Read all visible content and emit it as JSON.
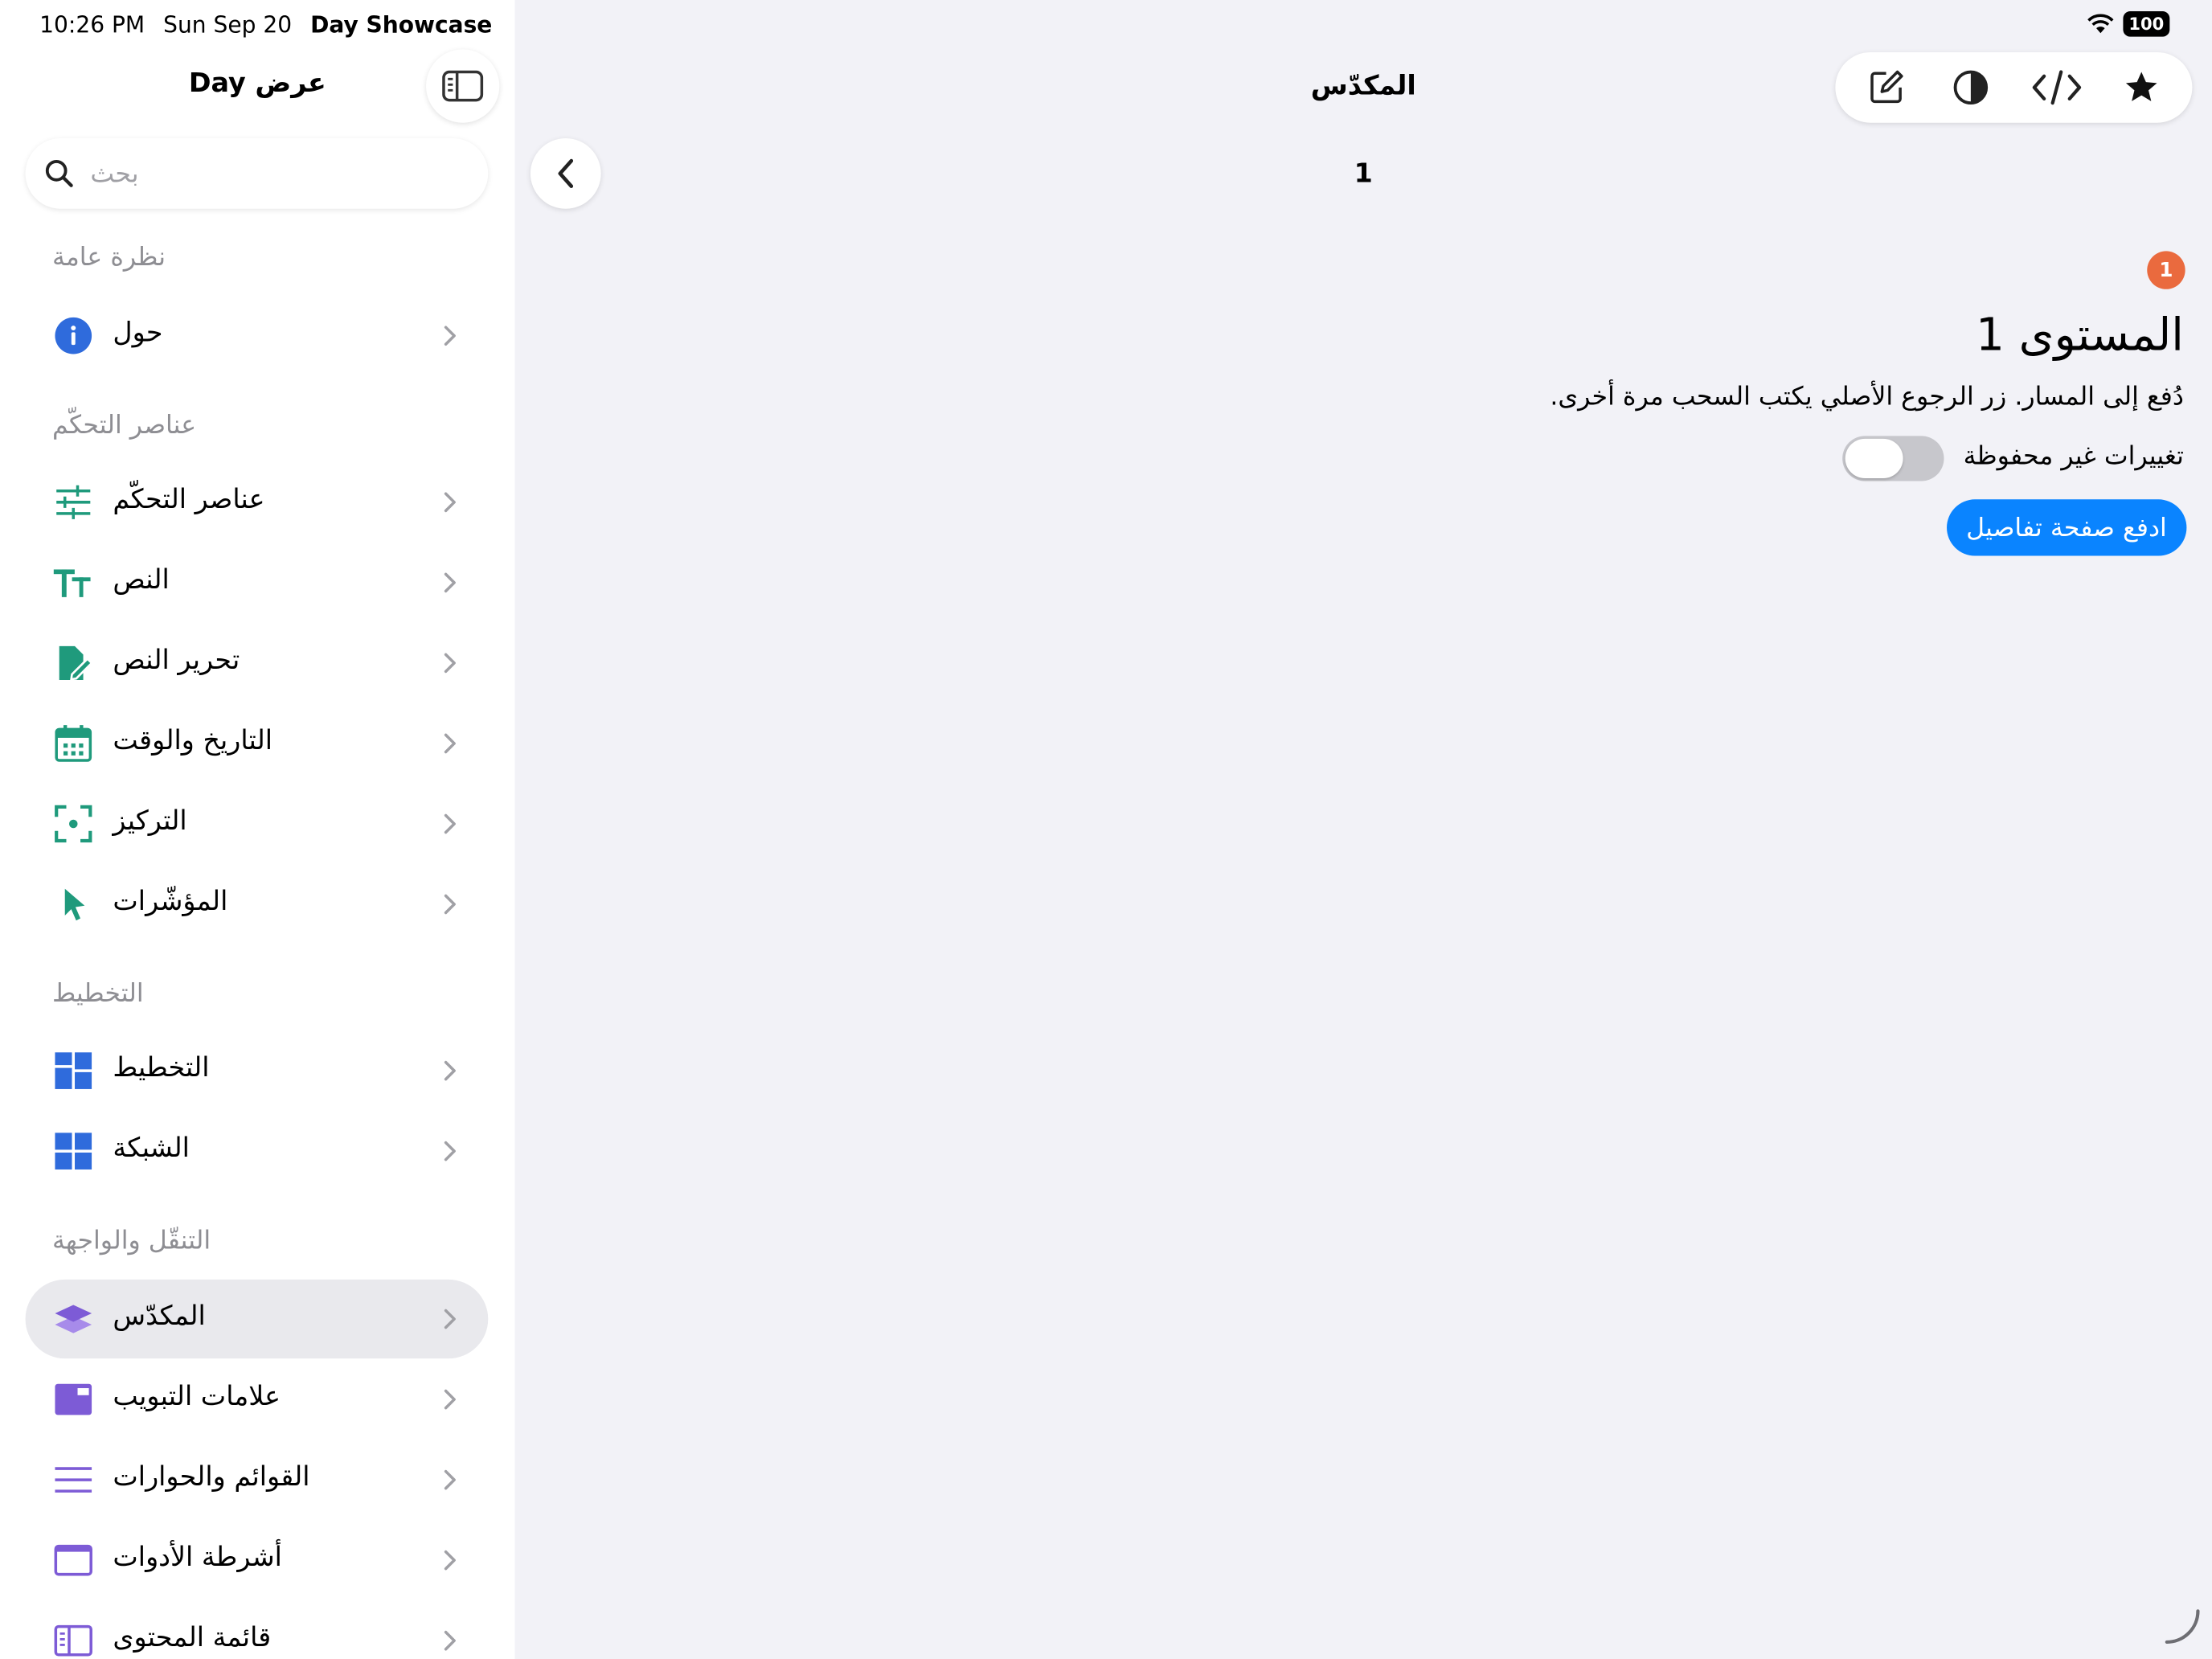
{
  "status_bar": {
    "time": "10:26 PM",
    "date": "Sun Sep 20",
    "app_name": "Day Showcase",
    "battery": "100"
  },
  "sidebar": {
    "title": "عرض Day",
    "search_placeholder": "بحث",
    "sections": [
      {
        "header": "نظرة عامة",
        "items": [
          {
            "label": "حول",
            "icon": "info-icon"
          }
        ]
      },
      {
        "header": "عناصر التحكّم",
        "items": [
          {
            "label": "عناصر التحكّم",
            "icon": "sliders-icon"
          },
          {
            "label": "النص",
            "icon": "text-size-icon"
          },
          {
            "label": "تحرير النص",
            "icon": "document-edit-icon"
          },
          {
            "label": "التاريخ والوقت",
            "icon": "calendar-icon"
          },
          {
            "label": "التركيز",
            "icon": "focus-icon"
          },
          {
            "label": "المؤشّرات",
            "icon": "pointer-icon"
          }
        ]
      },
      {
        "header": "التخطيط",
        "items": [
          {
            "label": "التخطيط",
            "icon": "layout-icon"
          },
          {
            "label": "الشبكة",
            "icon": "grid-icon"
          }
        ]
      },
      {
        "header": "التنقّل والواجهة",
        "items": [
          {
            "label": "المكدّس",
            "icon": "stack-icon",
            "selected": true
          },
          {
            "label": "علامات التبويب",
            "icon": "tabs-icon"
          },
          {
            "label": "القوائم والحوارات",
            "icon": "menu-lines-icon"
          },
          {
            "label": "أشرطة الأدوات",
            "icon": "toolbar-icon"
          },
          {
            "label": "قائمة المحتوى",
            "icon": "content-list-icon"
          }
        ]
      }
    ]
  },
  "main": {
    "nav_title": "المكدّس",
    "page_number": "1",
    "badge_count": "1",
    "level_title": "المستوى 1",
    "description": "دُفع إلى المسار. زر الرجوع الأصلي يكتب السحب مرة أخرى.",
    "unsaved_label": "تغييرات غير محفوظة",
    "unsaved_toggle_on": false,
    "push_button_label": "ادفع صفحة تفاصيل"
  },
  "colors": {
    "accent_blue": "#0a84ff",
    "teal": "#1f9a7c",
    "blue_icon": "#2f6bdc",
    "purple": "#7d5bd6",
    "badge_orange": "#ea6a3e"
  }
}
